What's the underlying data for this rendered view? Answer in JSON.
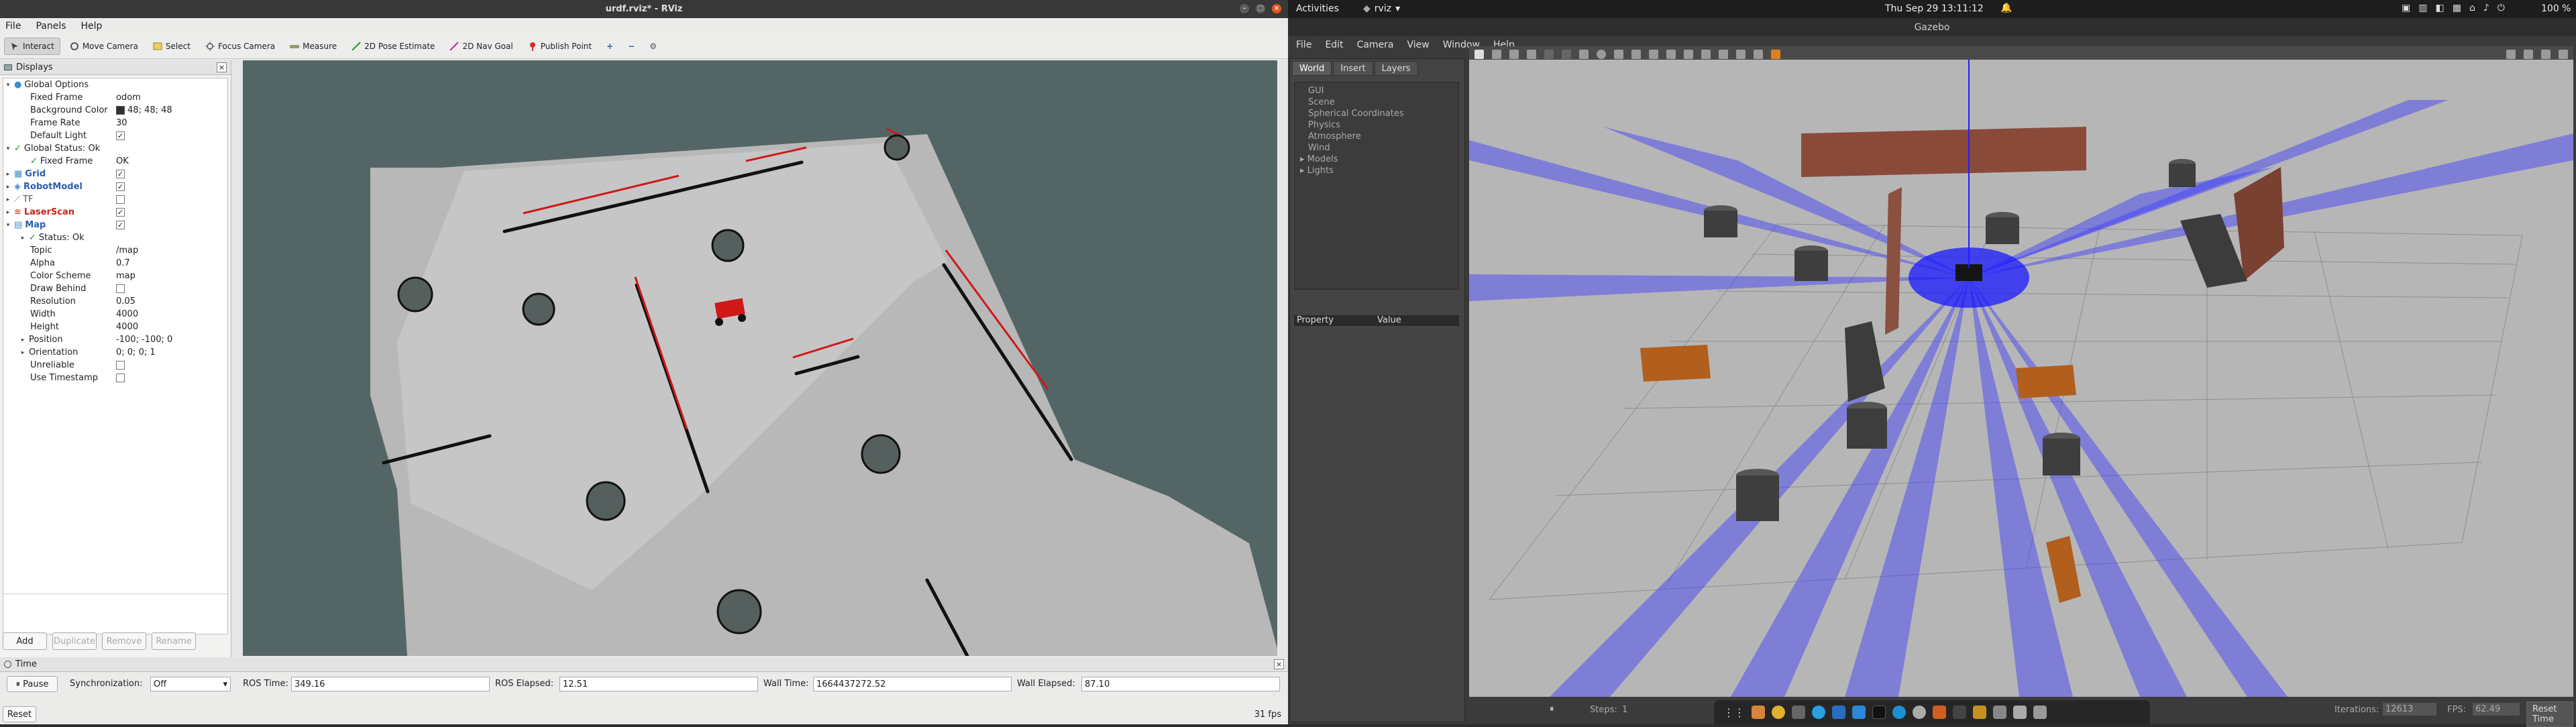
{
  "rviz": {
    "window_title": "urdf.rviz* - RViz",
    "menu": [
      "File",
      "Panels",
      "Help"
    ],
    "toolbar": [
      {
        "label": "Interact",
        "icon": "interact-icon",
        "active": true
      },
      {
        "label": "Move Camera",
        "icon": "move-camera-icon"
      },
      {
        "label": "Select",
        "icon": "select-icon"
      },
      {
        "label": "Focus Camera",
        "icon": "focus-camera-icon"
      },
      {
        "label": "Measure",
        "icon": "measure-icon"
      },
      {
        "label": "2D Pose Estimate",
        "icon": "pose-estimate-icon"
      },
      {
        "label": "2D Nav Goal",
        "icon": "nav-goal-icon"
      },
      {
        "label": "Publish Point",
        "icon": "publish-point-icon"
      }
    ],
    "displays": {
      "title": "Displays",
      "global_options": "Global Options",
      "fixed_frame_label": "Fixed Frame",
      "fixed_frame_value": "odom",
      "background_color_label": "Background Color",
      "background_color_value": "48; 48; 48",
      "frame_rate_label": "Frame Rate",
      "frame_rate_value": "30",
      "default_light_label": "Default Light",
      "global_status": "Global Status: Ok",
      "fixed_frame_status_label": "Fixed Frame",
      "fixed_frame_status_value": "OK",
      "grid": "Grid",
      "robot_model": "RobotModel",
      "tf": "TF",
      "laser_scan": "LaserScan",
      "map": "Map",
      "map_status": "Status: Ok",
      "topic_label": "Topic",
      "topic_value": "/map",
      "alpha_label": "Alpha",
      "alpha_value": "0.7",
      "color_scheme_label": "Color Scheme",
      "color_scheme_value": "map",
      "draw_behind_label": "Draw Behind",
      "resolution_label": "Resolution",
      "resolution_value": "0.05",
      "width_label": "Width",
      "width_value": "4000",
      "height_label": "Height",
      "height_value": "4000",
      "position_label": "Position",
      "position_value": "-100; -100; 0",
      "orientation_label": "Orientation",
      "orientation_value": "0; 0; 0; 1",
      "unreliable_label": "Unreliable",
      "use_timestamp_label": "Use Timestamp",
      "buttons": {
        "add": "Add",
        "duplicate": "Duplicate",
        "remove": "Remove",
        "rename": "Rename"
      }
    },
    "time": {
      "title": "Time",
      "pause": "Pause",
      "sync_label": "Synchronization:",
      "sync_value": "Off",
      "ros_time_label": "ROS Time:",
      "ros_time_value": "349.16",
      "ros_elapsed_label": "ROS Elapsed:",
      "ros_elapsed_value": "12.51",
      "wall_time_label": "Wall Time:",
      "wall_time_value": "1664437272.52",
      "wall_elapsed_label": "Wall Elapsed:",
      "wall_elapsed_value": "87.10",
      "reset": "Reset",
      "fps": "31 fps"
    }
  },
  "ubuntu_bar": {
    "activities": "Activities",
    "app": "rviz",
    "clock": "Thu Sep 29  13:11:12",
    "battery": "100 %"
  },
  "gazebo": {
    "title": "Gazebo",
    "menu": [
      "File",
      "Edit",
      "Camera",
      "View",
      "Window",
      "Help"
    ],
    "tabs": [
      "World",
      "Insert",
      "Layers"
    ],
    "tree": [
      "GUI",
      "Scene",
      "Spherical Coordinates",
      "Physics",
      "Atmosphere",
      "Wind",
      "Models",
      "Lights"
    ],
    "property_header": "Property",
    "value_header": "Value",
    "bottom": {
      "steps_label": "Steps:",
      "steps_value": "1",
      "iterations_label": "Iterations:",
      "iterations_value": "12613",
      "fps_label": "FPS:",
      "fps_value": "62.49",
      "reset_time": "Reset Time"
    }
  }
}
